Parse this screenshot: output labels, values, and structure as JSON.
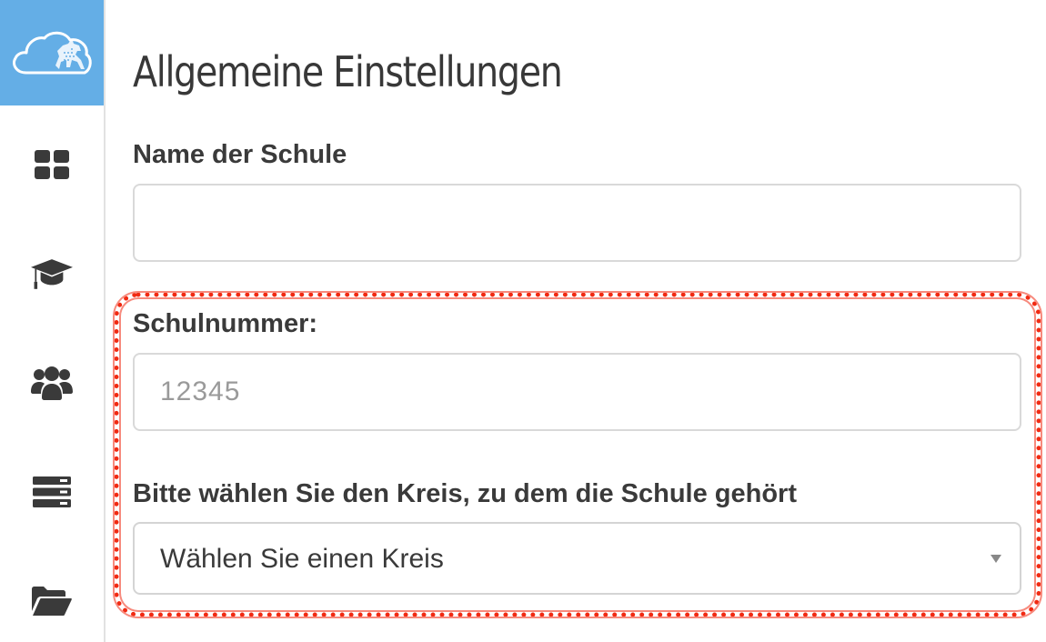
{
  "sidebar": {
    "logo_icon": "cloud-horse-logo-icon",
    "items": [
      {
        "icon": "dashboard-grid-icon"
      },
      {
        "icon": "graduation-cap-icon"
      },
      {
        "icon": "users-group-icon"
      },
      {
        "icon": "server-list-icon"
      },
      {
        "icon": "folder-open-icon"
      }
    ]
  },
  "main": {
    "title": "Allgemeine Einstellungen",
    "school_name": {
      "label": "Name der Schule",
      "value": "",
      "placeholder": ""
    },
    "school_number": {
      "label": "Schulnummer:",
      "value": "",
      "placeholder": "12345"
    },
    "district": {
      "label": "Bitte wählen Sie den Kreis, zu dem die Schule gehört",
      "selected": "Wählen Sie einen Kreis"
    }
  },
  "colors": {
    "logo_background": "#64aee6",
    "highlight": "#f12a12",
    "icon": "#3a3a3a"
  }
}
